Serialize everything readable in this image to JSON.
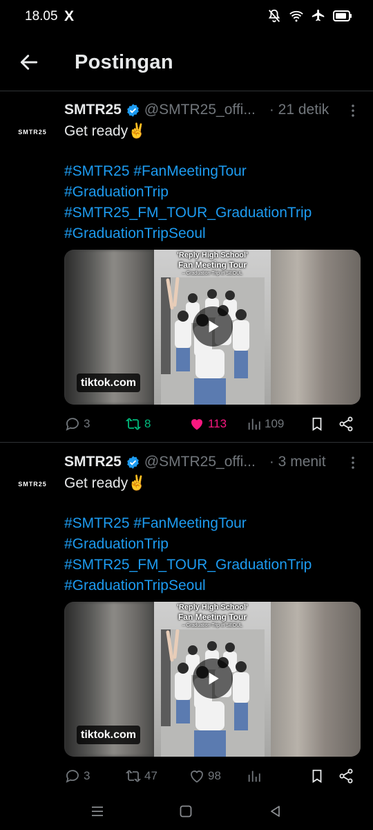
{
  "status_bar": {
    "time": "18.05",
    "app_badge": "X",
    "icons": [
      "mute-icon",
      "wifi-icon",
      "airplane-icon",
      "battery-icon"
    ]
  },
  "header": {
    "title": "Postingan",
    "back_icon": "arrow-left-icon"
  },
  "colors": {
    "background": "#000000",
    "text": "#e7e9ea",
    "muted": "#71767b",
    "link": "#1d9bf0",
    "retweet_active": "#00ba7c",
    "like_active": "#f91880",
    "divider": "#2f3336"
  },
  "tweets": [
    {
      "avatar_text": "SMTR25",
      "name": "SMTR25",
      "verified": true,
      "handle": "@SMTR25_offi...",
      "time": "· 21 detik",
      "text": "Get ready✌️",
      "hashtags": [
        "#SMTR25 #FanMeetingTour",
        "#GraduationTrip",
        "#SMTR25_FM_TOUR_GraduationTrip",
        "#GraduationTripSeoul"
      ],
      "media": {
        "poster_line1": "'Reply High School'",
        "poster_line2": "Fan Meeting Tour",
        "poster_line3": "– Graduation Trip in SEOUL",
        "source_label": "tiktok.com"
      },
      "stats": {
        "replies": "3",
        "retweets": "8",
        "likes": "113",
        "views": "109"
      },
      "liked": true,
      "retweeted": true
    },
    {
      "avatar_text": "SMTR25",
      "name": "SMTR25",
      "verified": true,
      "handle": "@SMTR25_offi...",
      "time": "· 3 menit",
      "text": "Get ready✌️",
      "hashtags": [
        "#SMTR25 #FanMeetingTour",
        "#GraduationTrip",
        "#SMTR25_FM_TOUR_GraduationTrip",
        "#GraduationTripSeoul"
      ],
      "media": {
        "poster_line1": "'Reply High School'",
        "poster_line2": "Fan Meeting Tour",
        "poster_line3": "– Graduation Trip in SEOUL",
        "source_label": "tiktok.com"
      },
      "stats": {
        "replies": "3",
        "retweets": "47",
        "likes": "98",
        "views": ""
      },
      "liked": false,
      "retweeted": false
    }
  ],
  "nav_bar": {
    "buttons": [
      "menu-icon",
      "home-square-icon",
      "back-triangle-icon"
    ]
  }
}
